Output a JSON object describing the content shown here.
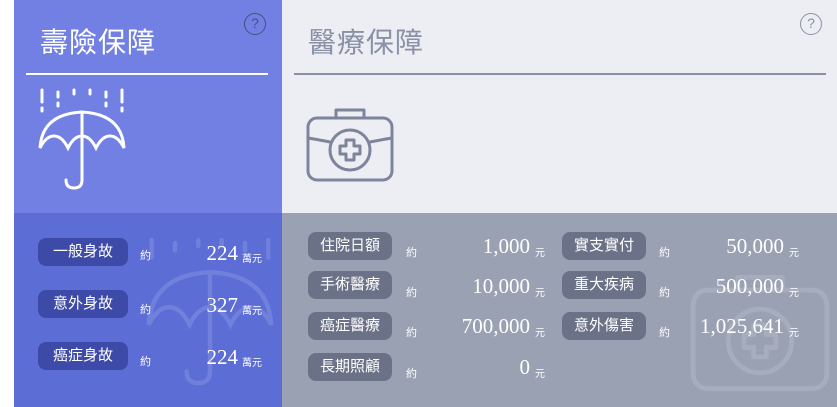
{
  "life": {
    "title": "壽險保障",
    "help": "?",
    "icon": "umbrella-rain-icon",
    "rows": [
      {
        "label": "一般身故",
        "prefix": "約",
        "amount": "224",
        "unit": "萬元"
      },
      {
        "label": "意外身故",
        "prefix": "約",
        "amount": "327",
        "unit": "萬元"
      },
      {
        "label": "癌症身故",
        "prefix": "約",
        "amount": "224",
        "unit": "萬元"
      }
    ]
  },
  "medical": {
    "title": "醫療保障",
    "help": "?",
    "icon": "medical-kit-icon",
    "left_rows": [
      {
        "label": "住院日額",
        "prefix": "約",
        "amount": "1,000",
        "unit": "元"
      },
      {
        "label": "手術醫療",
        "prefix": "約",
        "amount": "10,000",
        "unit": "元"
      },
      {
        "label": "癌症醫療",
        "prefix": "約",
        "amount": "700,000",
        "unit": "元"
      },
      {
        "label": "長期照顧",
        "prefix": "約",
        "amount": "0",
        "unit": "元"
      }
    ],
    "right_rows": [
      {
        "label": "實支實付",
        "prefix": "約",
        "amount": "50,000",
        "unit": "元"
      },
      {
        "label": "重大疾病",
        "prefix": "約",
        "amount": "500,000",
        "unit": "元"
      },
      {
        "label": "意外傷害",
        "prefix": "約",
        "amount": "1,025,641",
        "unit": "元"
      }
    ]
  },
  "colors": {
    "life_top": "#7280e3",
    "life_bottom": "#5c6dd6",
    "life_tag": "#3d4aa8",
    "medical_top": "#eceef4",
    "medical_bottom": "#9aa1b3",
    "medical_tag": "#6b7287"
  }
}
